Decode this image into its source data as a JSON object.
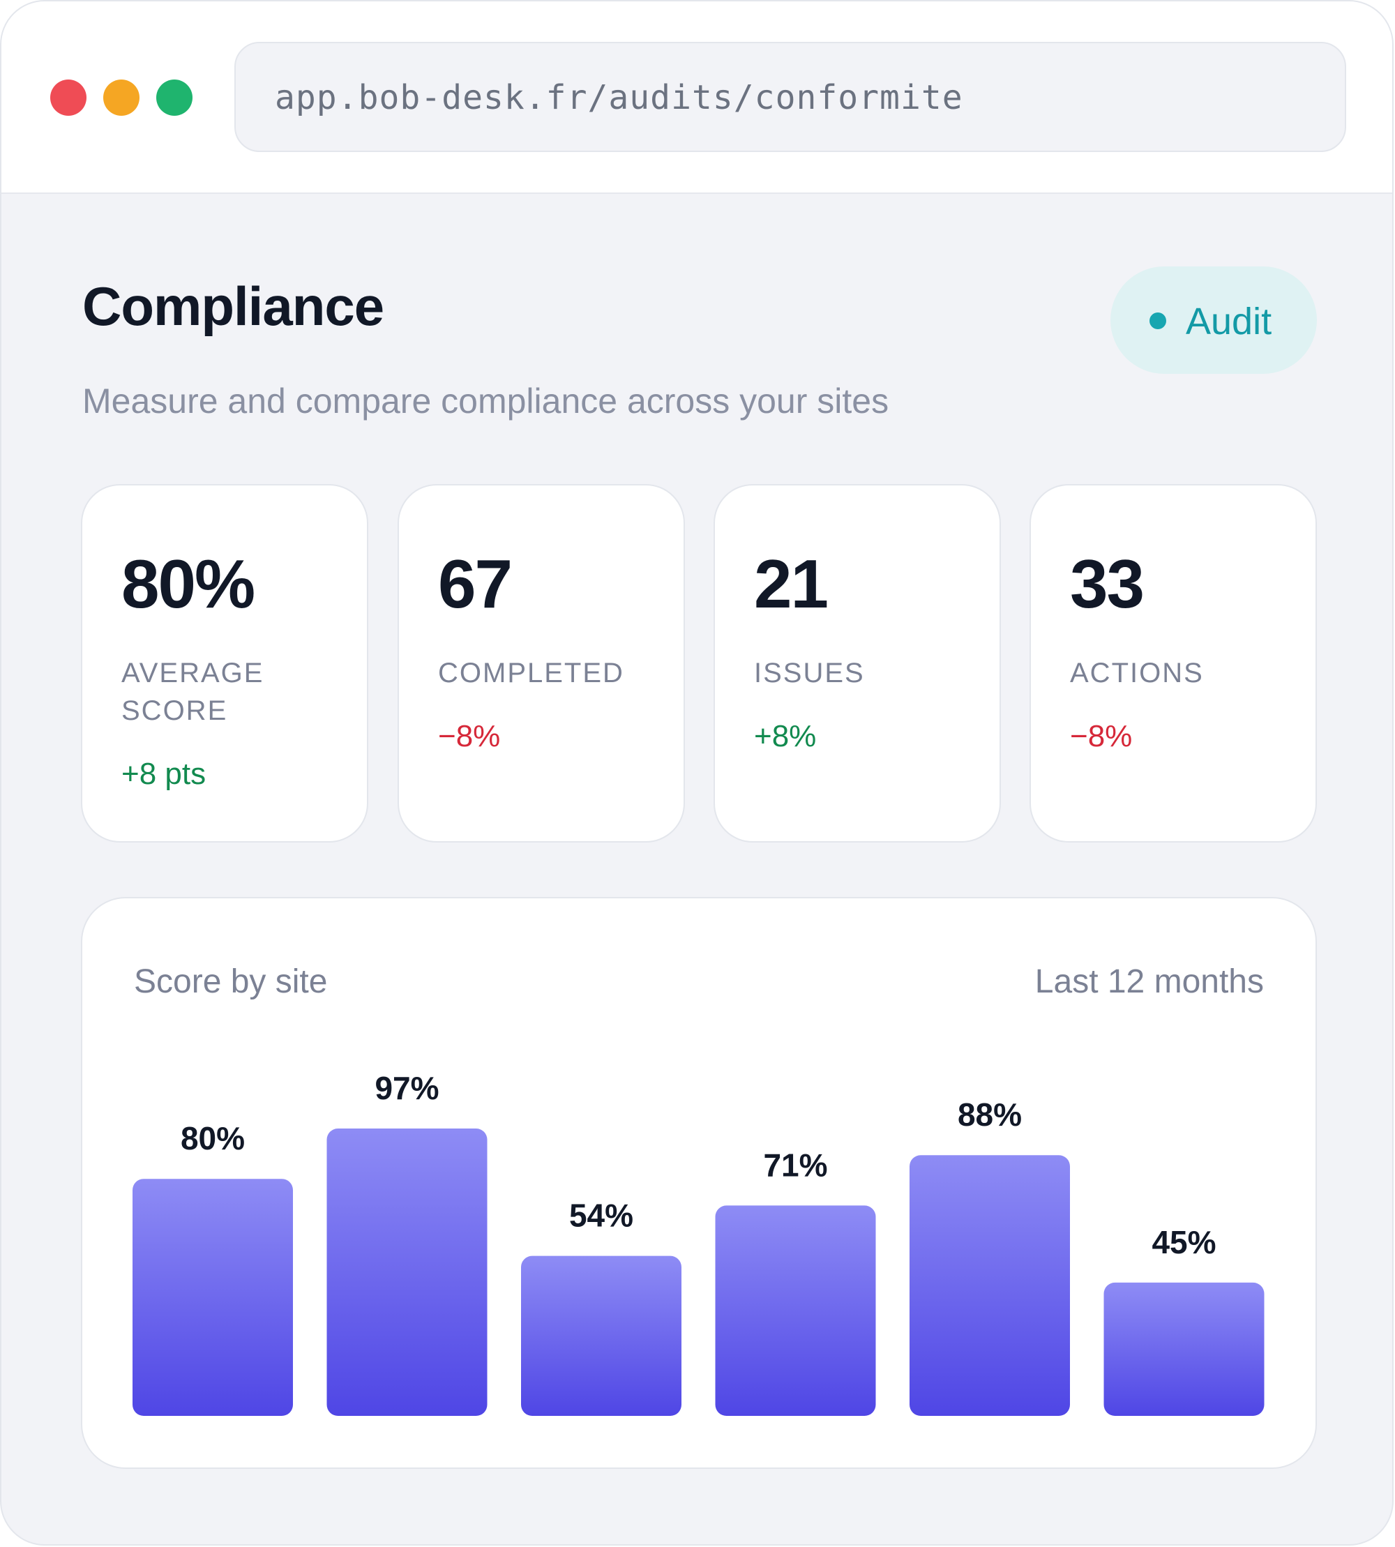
{
  "browser": {
    "url": "app.bob-desk.fr/audits/conformite",
    "window_controls": [
      "close",
      "minimize",
      "maximize"
    ]
  },
  "header": {
    "title": "Compliance",
    "subtitle": "Measure and compare compliance across your sites",
    "badge_label": "Audit",
    "badge_color": "#17a6b0"
  },
  "kpis": [
    {
      "value": "80%",
      "label": "AVERAGE SCORE",
      "delta": "+8 pts",
      "trend": "up"
    },
    {
      "value": "67",
      "label": "COMPLETED",
      "delta": "−8%",
      "trend": "down"
    },
    {
      "value": "21",
      "label": "ISSUES",
      "delta": "+8%",
      "trend": "up"
    },
    {
      "value": "33",
      "label": "ACTIONS",
      "delta": "−8%",
      "trend": "down"
    }
  ],
  "chart": {
    "title": "Score by site",
    "period": "Last 12 months"
  },
  "chart_data": {
    "type": "bar",
    "categories": [
      "",
      "",
      "",
      "",
      "",
      ""
    ],
    "values": [
      80,
      97,
      54,
      71,
      88,
      45
    ],
    "labels": [
      "80%",
      "97%",
      "54%",
      "71%",
      "88%",
      "45%"
    ],
    "ylim": [
      0,
      100
    ],
    "colors": {
      "bar_top": "#8e8cf5",
      "bar_bottom": "#4f46e5"
    },
    "grid": false,
    "legend": "none"
  }
}
